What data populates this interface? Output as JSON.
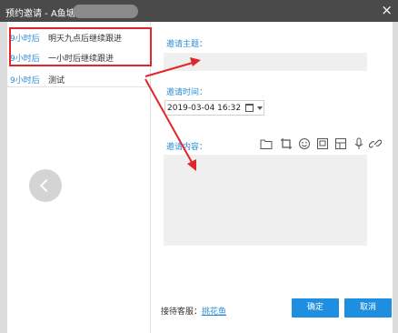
{
  "window": {
    "title": "预约邀请 - A鱼塘",
    "close_glyph": "×"
  },
  "followups": [
    {
      "time": "9小时后",
      "text": "明天九点后继续跟进"
    },
    {
      "time": "9小时后",
      "text": "一小时后继续跟进"
    },
    {
      "time": "9小时后",
      "text": "测试"
    }
  ],
  "form": {
    "subject_label": "邀请主题：",
    "subject_value": "",
    "time_label": "邀请时间：",
    "time_value": "2019-03-04 16:32",
    "content_label": "邀请内容：",
    "content_value": ""
  },
  "toolbar_icons": [
    "folder-icon",
    "crop-icon",
    "emoji-icon",
    "image-icon",
    "template-icon",
    "microphone-icon",
    "link-icon"
  ],
  "footer": {
    "reception_label": "接待客服：",
    "reception_name": "挑花鱼",
    "confirm_label": "确定",
    "cancel_label": "取消"
  },
  "colors": {
    "accent": "#1e8fe0",
    "link": "#2b8cd6",
    "highlight": "#e0252b",
    "titlebar": "#4a4a4a"
  }
}
